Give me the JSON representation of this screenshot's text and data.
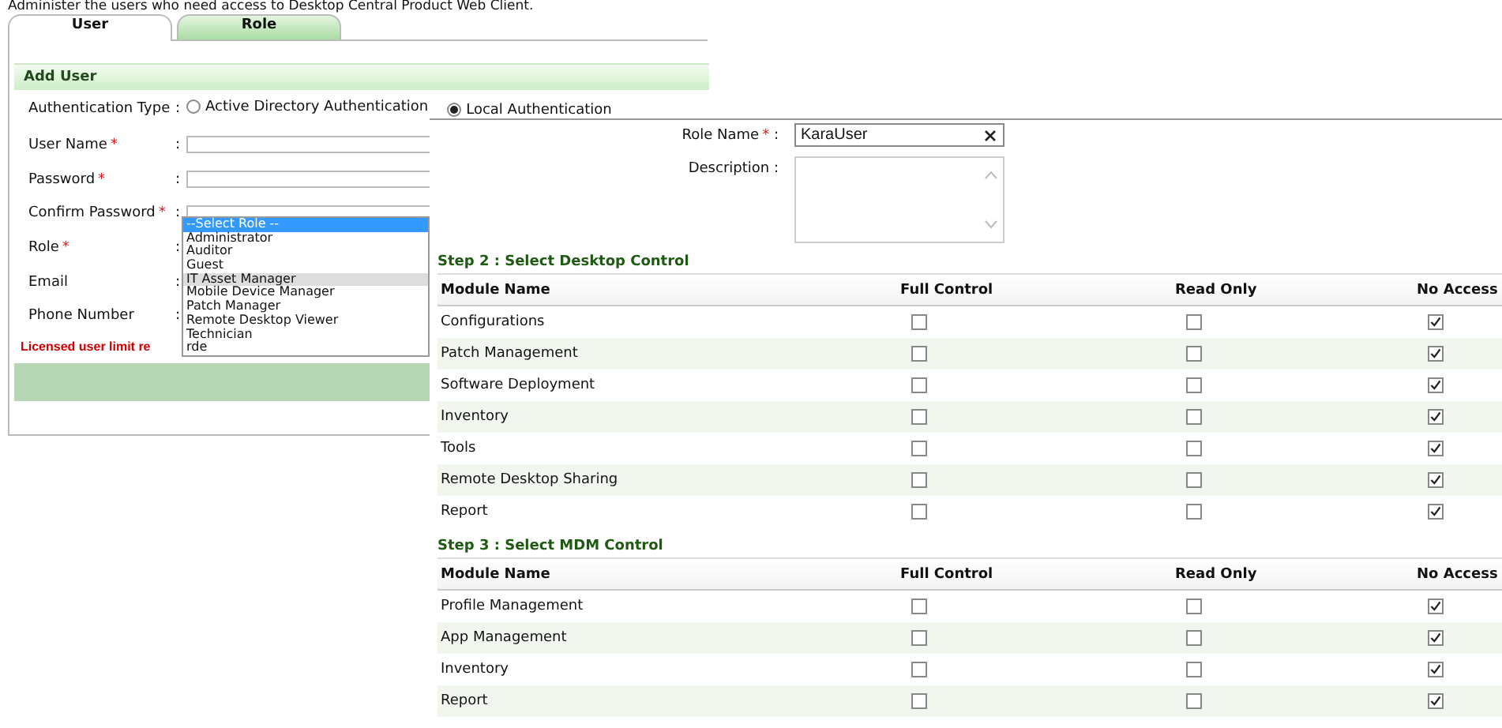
{
  "intro": "Administer the users who need access to Desktop Central Product Web Client.",
  "tabs": [
    {
      "label": "User",
      "selected": true
    },
    {
      "label": "Role",
      "selected": false
    }
  ],
  "add_user": {
    "title": "Add User",
    "auth": {
      "label": "Authentication Type",
      "colon": ":",
      "options": [
        {
          "label": "Active Directory Authentication",
          "selected": false
        },
        {
          "label": "Local Authentication",
          "selected": true
        }
      ]
    },
    "fields": [
      {
        "label": "User Name",
        "mark": "*",
        "colon": ":",
        "kind": "input"
      },
      {
        "label": "Password",
        "mark": "*",
        "colon": ":",
        "kind": "input"
      },
      {
        "label": "Confirm Password",
        "mark": "*",
        "colon": ":",
        "kind": "input"
      },
      {
        "label": "Role",
        "mark": "*",
        "colon": ":",
        "kind": "select"
      },
      {
        "label": "Email",
        "colon": ":",
        "kind": "hidden"
      },
      {
        "label": "Phone Number",
        "colon": ":",
        "kind": "hidden"
      }
    ],
    "role_options": [
      {
        "label": "--Select Role --",
        "selected": true,
        "hovered": false
      },
      {
        "label": "Administrator",
        "selected": false,
        "hovered": false
      },
      {
        "label": "Auditor",
        "selected": false,
        "hovered": false
      },
      {
        "label": "Guest",
        "selected": false,
        "hovered": false
      },
      {
        "label": "IT Asset Manager",
        "selected": false,
        "hovered": true
      },
      {
        "label": "Mobile Device Manager",
        "selected": false,
        "hovered": false
      },
      {
        "label": "Patch Manager",
        "selected": false,
        "hovered": false
      },
      {
        "label": "Remote Desktop Viewer",
        "selected": false,
        "hovered": false
      },
      {
        "label": "Technician",
        "selected": false,
        "hovered": false
      },
      {
        "label": "rde",
        "selected": false,
        "hovered": false
      }
    ],
    "warning": "Licensed user limit re"
  },
  "role": {
    "name_label": "Role Name",
    "name_mark": "*",
    "name_colon": ":",
    "name_value": "KaraUser",
    "description_label": "Description :",
    "sections": [
      {
        "title": "Step 2 : Select Desktop Control",
        "columns": [
          "Module Name",
          "Full Control",
          "Read Only",
          "No Access"
        ],
        "rows": [
          {
            "module": "Configurations",
            "full_control": false,
            "read_only": false,
            "no_access": true
          },
          {
            "module": "Patch Management",
            "full_control": false,
            "read_only": false,
            "no_access": true
          },
          {
            "module": "Software Deployment",
            "full_control": false,
            "read_only": false,
            "no_access": true
          },
          {
            "module": "Inventory",
            "full_control": false,
            "read_only": false,
            "no_access": true
          },
          {
            "module": "Tools",
            "full_control": false,
            "read_only": false,
            "no_access": true
          },
          {
            "module": "Remote Desktop Sharing",
            "full_control": false,
            "read_only": false,
            "no_access": true
          },
          {
            "module": "Report",
            "full_control": false,
            "read_only": false,
            "no_access": true
          }
        ]
      },
      {
        "title": "Step 3 : Select MDM Control",
        "columns": [
          "Module Name",
          "Full Control",
          "Read Only",
          "No Access"
        ],
        "rows": [
          {
            "module": "Profile Management",
            "full_control": false,
            "read_only": false,
            "no_access": true
          },
          {
            "module": "App Management",
            "full_control": false,
            "read_only": false,
            "no_access": true
          },
          {
            "module": "Inventory",
            "full_control": false,
            "read_only": false,
            "no_access": true
          },
          {
            "module": "Report",
            "full_control": false,
            "read_only": false,
            "no_access": true
          }
        ]
      }
    ]
  }
}
